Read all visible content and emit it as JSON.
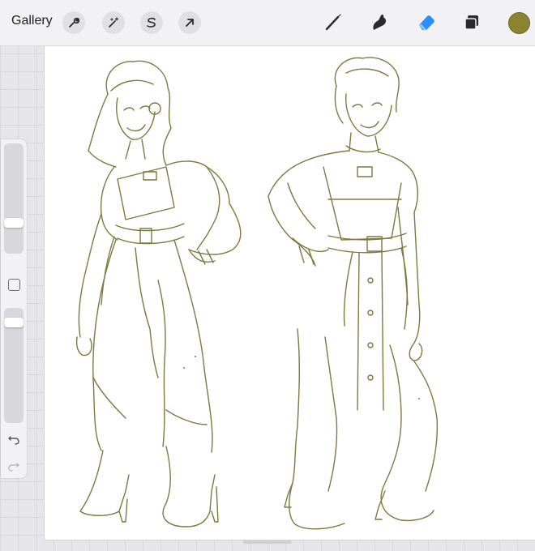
{
  "topbar": {
    "gallery_label": "Gallery",
    "left_tools": [
      {
        "name": "actions",
        "icon": "wrench-icon"
      },
      {
        "name": "adjustments",
        "icon": "magic-wand-icon"
      },
      {
        "name": "selection",
        "icon": "selection-s-icon"
      },
      {
        "name": "transform",
        "icon": "arrow-cursor-icon"
      }
    ],
    "right_tools": [
      {
        "name": "brush",
        "icon": "brush-icon"
      },
      {
        "name": "smudge",
        "icon": "smudge-finger-icon"
      },
      {
        "name": "eraser",
        "icon": "eraser-icon",
        "active": true
      },
      {
        "name": "layers",
        "icon": "layers-icon"
      }
    ],
    "current_color": "#8c8332"
  },
  "sidebar": {
    "brush_size_level": 0.74,
    "opacity_level": 0.09,
    "icons": [
      "modify-square-icon",
      "undo-icon",
      "redo-icon"
    ]
  },
  "canvas": {
    "content": "line-art-sketch-two-characters",
    "line_color": "#7b7a40",
    "accent_color": "#2f8cff"
  }
}
